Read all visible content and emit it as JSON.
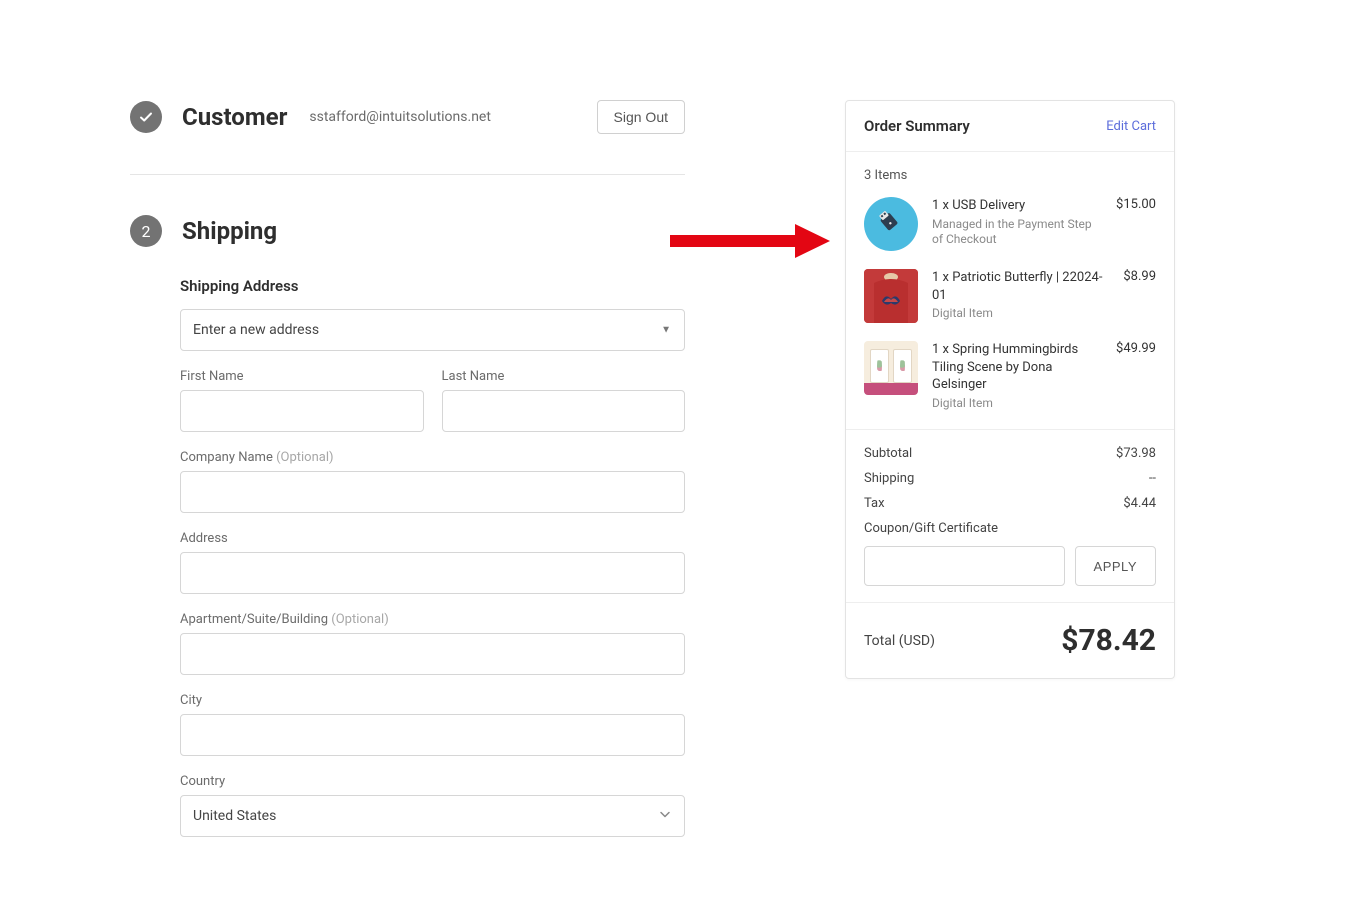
{
  "customer": {
    "title": "Customer",
    "email": "sstafford@intuitsolutions.net",
    "signout": "Sign Out"
  },
  "shipping": {
    "badge": "2",
    "title": "Shipping",
    "address_heading": "Shipping Address",
    "address_select": "Enter a new address",
    "labels": {
      "first_name": "First Name",
      "last_name": "Last Name",
      "company": "Company Name",
      "company_optional": "(Optional)",
      "address": "Address",
      "apt": "Apartment/Suite/Building",
      "apt_optional": "(Optional)",
      "city": "City",
      "country": "Country"
    },
    "country_value": "United States"
  },
  "summary": {
    "title": "Order Summary",
    "edit": "Edit Cart",
    "items_count": "3 Items",
    "items": [
      {
        "name": "1 x USB Delivery",
        "sub": "Managed in the Payment Step of Checkout",
        "price": "$15.00"
      },
      {
        "name": "1 x Patriotic Butterfly | 22024-01",
        "sub": "Digital Item",
        "price": "$8.99"
      },
      {
        "name": "1 x Spring Hummingbirds Tiling Scene by Dona Gelsinger",
        "sub": "Digital Item",
        "price": "$49.99"
      }
    ],
    "subtotal_label": "Subtotal",
    "subtotal": "$73.98",
    "shipping_label": "Shipping",
    "shipping": "--",
    "tax_label": "Tax",
    "tax": "$4.44",
    "coupon_label": "Coupon/Gift Certificate",
    "apply": "APPLY",
    "total_label": "Total (USD)",
    "total": "$78.42"
  }
}
